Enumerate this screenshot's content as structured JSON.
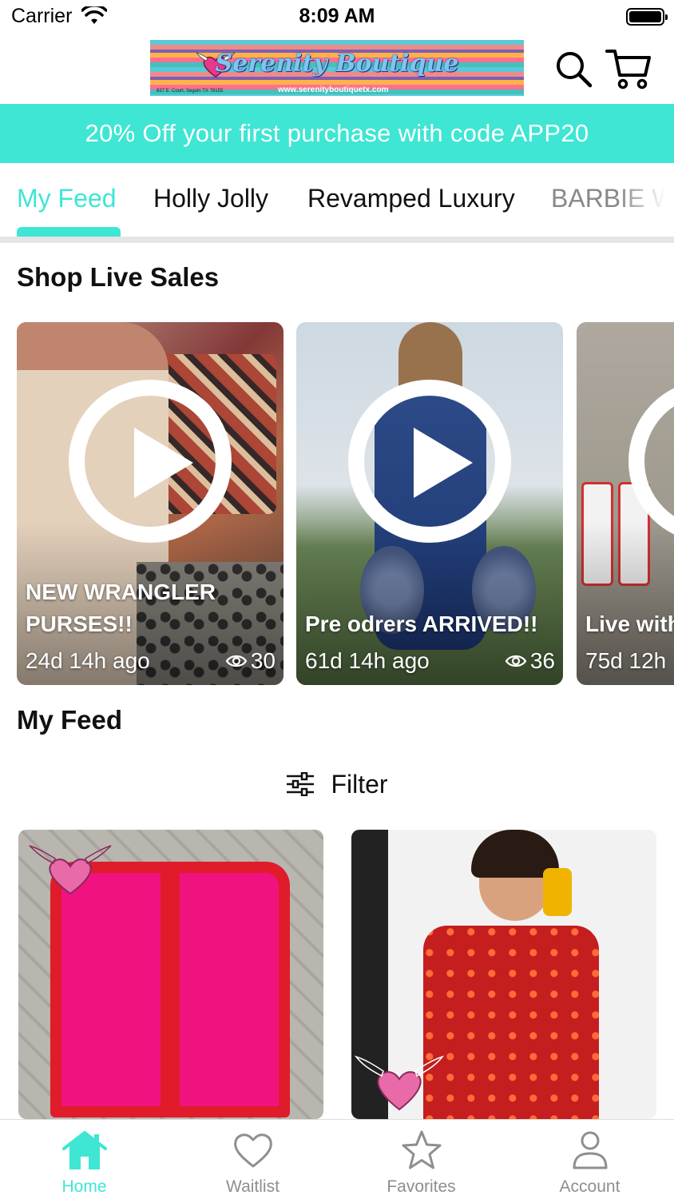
{
  "status_bar": {
    "carrier": "Carrier",
    "time": "8:09 AM"
  },
  "header": {
    "logo_text": "Serenity Boutique",
    "logo_address": "837 E. Court, Seguin TX 78155",
    "logo_url": "www.serenityboutiquetx.com"
  },
  "promo": {
    "text": "20% Off your first purchase with code APP20"
  },
  "tabs": [
    {
      "label": "My Feed",
      "active": true
    },
    {
      "label": "Holly Jolly",
      "active": false
    },
    {
      "label": "Revamped Luxury",
      "active": false
    },
    {
      "label": "BARBIE W",
      "active": false
    }
  ],
  "live_sales": {
    "title": "Shop Live Sales",
    "cards": [
      {
        "title": "NEW WRANGLER PURSES!!",
        "time": "24d 14h ago",
        "views": "30"
      },
      {
        "title": "Pre odrers ARRIVED!!",
        "time": "61d 14h ago",
        "views": "36"
      },
      {
        "title": "Live with",
        "time": "75d 12h",
        "views": ""
      }
    ]
  },
  "feed": {
    "title": "My Feed",
    "filter_label": "Filter"
  },
  "tabbar": [
    {
      "label": "Home",
      "icon": "home-icon",
      "active": true
    },
    {
      "label": "Waitlist",
      "icon": "heart-icon",
      "active": false
    },
    {
      "label": "Favorites",
      "icon": "star-icon",
      "active": false
    },
    {
      "label": "Account",
      "icon": "person-icon",
      "active": false
    }
  ],
  "colors": {
    "accent": "#3ee6d3",
    "inactive": "#8e8e93"
  }
}
